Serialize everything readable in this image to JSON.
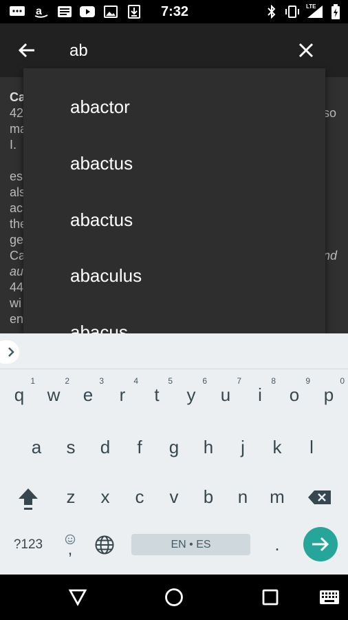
{
  "status_bar": {
    "time": "7:32",
    "icons": [
      "messages-icon",
      "amazon-icon",
      "news-icon",
      "youtube-icon",
      "photos-icon",
      "download-icon",
      "bluetooth-icon",
      "vibrate-icon",
      "lte-signal-icon",
      "battery-icon"
    ],
    "network_label": "LTE"
  },
  "search": {
    "query": "ab"
  },
  "content_peek": {
    "lines": [
      "Ca",
      "42",
      "ma",
      "  I.",
      "",
      "es",
      "als",
      "ac",
      "the",
      "ge",
      "Ca",
      "au",
      "44",
      "wi",
      "en"
    ],
    "right_lines": [
      "so",
      "",
      "",
      "",
      "",
      "",
      "",
      "",
      "",
      "nd"
    ]
  },
  "suggestions": [
    "abactor",
    "abactus",
    "abactus",
    "abaculus",
    "abacus"
  ],
  "keyboard": {
    "row1": [
      {
        "key": "q",
        "hint": "1"
      },
      {
        "key": "w",
        "hint": "2"
      },
      {
        "key": "e",
        "hint": "3"
      },
      {
        "key": "r",
        "hint": "4"
      },
      {
        "key": "t",
        "hint": "5"
      },
      {
        "key": "y",
        "hint": "6"
      },
      {
        "key": "u",
        "hint": "7"
      },
      {
        "key": "i",
        "hint": "8"
      },
      {
        "key": "o",
        "hint": "9"
      },
      {
        "key": "p",
        "hint": "0"
      }
    ],
    "row2": [
      "a",
      "s",
      "d",
      "f",
      "g",
      "h",
      "j",
      "k",
      "l"
    ],
    "row3": [
      "z",
      "x",
      "c",
      "v",
      "b",
      "n",
      "m"
    ],
    "symbols_label": "?123",
    "comma_label": ",",
    "space_label": "EN • ES",
    "period_label": "."
  },
  "colors": {
    "accent": "#26a69a",
    "appbar": "#212121",
    "dropdown": "#2e2e2e",
    "keyboard_bg": "#eceff1"
  }
}
